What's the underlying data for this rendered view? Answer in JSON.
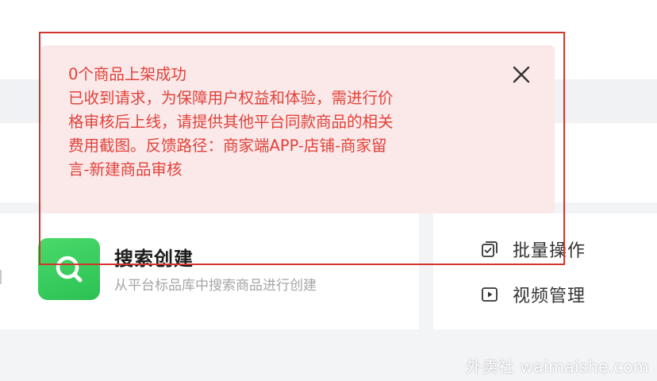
{
  "notice": {
    "title": "0个商品上架成功",
    "lines": [
      "已收到请求，为保障用户权益和体验，需进行价",
      "格审核后上线，请提供其他平台同款商品的相关",
      "费用截图。反馈路径：商家端APP-店铺-商家留",
      "言-新建商品审核"
    ],
    "close_icon": "close-icon",
    "text_color": "#e0423b",
    "background_color": "#fbe9e9",
    "highlight_border_color": "#d4342e"
  },
  "create_options": {
    "search_create": {
      "title": "搜索创建",
      "description": "从平台标品库中搜索商品进行创建",
      "icon": "search-icon",
      "icon_color": "#39cc5e"
    }
  },
  "actions": [
    {
      "label": "批量操作",
      "icon": "batch-edit-icon"
    },
    {
      "label": "视频管理",
      "icon": "video-play-icon"
    }
  ],
  "watermark": "外卖社 waimaishe.com"
}
